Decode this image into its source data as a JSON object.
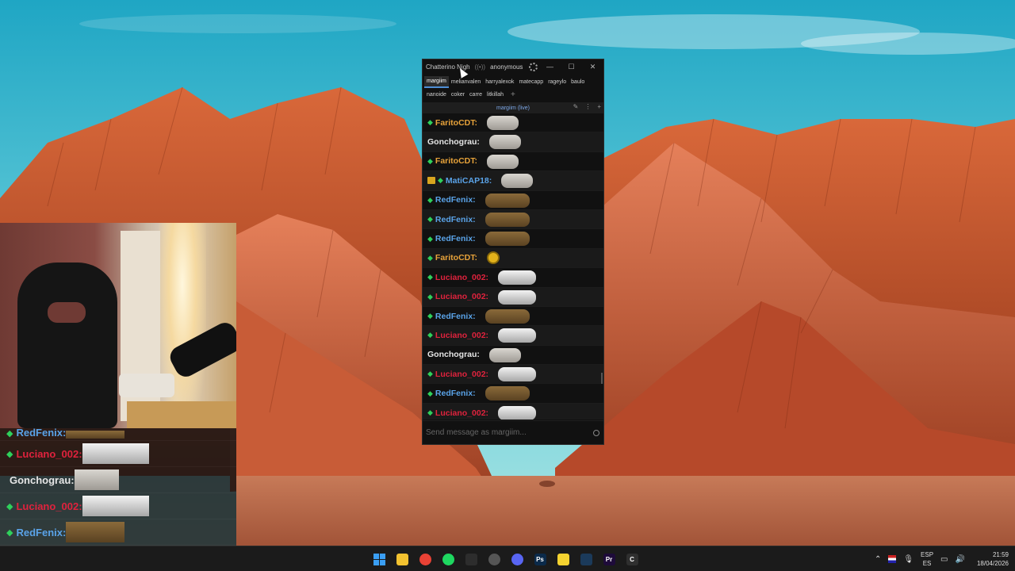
{
  "chatterino": {
    "title": "Chatterino Nigh",
    "account": "anonymous",
    "tabs_row1": [
      "margiim",
      "melianvalen",
      "harryalexok",
      "matecapp",
      "rageylo",
      "baulo"
    ],
    "tabs_row2": [
      "nanoide",
      "coker",
      "carre",
      "litkillah"
    ],
    "active_tab": "margiim",
    "split_title": "margiim (live)",
    "input_placeholder": "Send message as margiim...",
    "messages": [
      {
        "user": "FaritoCDT:",
        "color": "#e8a33a",
        "badge": "diamond",
        "emote": "seal"
      },
      {
        "user": "Gonchograu:",
        "color": "#e6e6e6",
        "badge": "none",
        "emote": "seal"
      },
      {
        "user": "FaritoCDT:",
        "color": "#e8a33a",
        "badge": "diamond",
        "emote": "seal"
      },
      {
        "user": "MatiCAP18:",
        "color": "#5aa3e8",
        "badge": "crown+diamond",
        "emote": "seal"
      },
      {
        "user": "RedFenix:",
        "color": "#5aa3e8",
        "badge": "diamond",
        "emote": "tank"
      },
      {
        "user": "RedFenix:",
        "color": "#5aa3e8",
        "badge": "diamond",
        "emote": "tank"
      },
      {
        "user": "RedFenix:",
        "color": "#5aa3e8",
        "badge": "diamond",
        "emote": "tank"
      },
      {
        "user": "FaritoCDT:",
        "color": "#e8a33a",
        "badge": "diamond",
        "emote": "coin"
      },
      {
        "user": "Luciano_002:",
        "color": "#e0223d",
        "badge": "diamond",
        "emote": "cat"
      },
      {
        "user": "Luciano_002:",
        "color": "#e0223d",
        "badge": "diamond",
        "emote": "cat"
      },
      {
        "user": "RedFenix:",
        "color": "#5aa3e8",
        "badge": "diamond",
        "emote": "tank"
      },
      {
        "user": "Luciano_002:",
        "color": "#e0223d",
        "badge": "diamond",
        "emote": "cat"
      },
      {
        "user": "Gonchograu:",
        "color": "#e6e6e6",
        "badge": "none",
        "emote": "seal"
      },
      {
        "user": "Luciano_002:",
        "color": "#e0223d",
        "badge": "diamond",
        "emote": "cat"
      },
      {
        "user": "RedFenix:",
        "color": "#5aa3e8",
        "badge": "diamond",
        "emote": "tank"
      },
      {
        "user": "Luciano_002:",
        "color": "#e0223d",
        "badge": "diamond",
        "emote": "cat"
      }
    ]
  },
  "overlay_chat": [
    {
      "user": "RedFenix:",
      "color": "#5aa3e8",
      "badge": "diamond",
      "emote": "tank",
      "partial": true
    },
    {
      "user": "Luciano_002:",
      "color": "#e0223d",
      "badge": "diamond",
      "emote": "cat"
    },
    {
      "user": "Gonchograu:",
      "color": "#e6e6e6",
      "badge": "none",
      "emote": "seal"
    },
    {
      "user": "Luciano_002:",
      "color": "#e0223d",
      "badge": "diamond",
      "emote": "cat"
    },
    {
      "user": "RedFenix:",
      "color": "#5aa3e8",
      "badge": "diamond",
      "emote": "tank"
    },
    {
      "user": "Luciano_002:",
      "color": "#e0223d",
      "badge": "diamond",
      "emote": "cat"
    }
  ],
  "taskbar": {
    "apps": [
      {
        "name": "start",
        "icon": "windows-icon",
        "color": "#3a9ff5",
        "glyph": ""
      },
      {
        "name": "file-explorer",
        "icon": "folder-icon",
        "color": "#f2c230",
        "glyph": ""
      },
      {
        "name": "chrome",
        "icon": "chrome-icon",
        "color": "#e94235",
        "glyph": ""
      },
      {
        "name": "spotify",
        "icon": "spotify-icon",
        "color": "#1ed760",
        "glyph": ""
      },
      {
        "name": "app-dark",
        "icon": "terminal-icon",
        "color": "#2d2d2d",
        "glyph": ""
      },
      {
        "name": "opera-gx",
        "icon": "opera-icon",
        "color": "#555555",
        "glyph": ""
      },
      {
        "name": "discord",
        "icon": "discord-icon",
        "color": "#5865f2",
        "glyph": ""
      },
      {
        "name": "photoshop",
        "icon": "photoshop-icon",
        "color": "#0b2a4a",
        "glyph": "Ps"
      },
      {
        "name": "sticky-notes",
        "icon": "note-icon",
        "color": "#f5d330",
        "glyph": ""
      },
      {
        "name": "steam",
        "icon": "steam-icon",
        "color": "#1b3a5a",
        "glyph": ""
      },
      {
        "name": "premiere",
        "icon": "premiere-icon",
        "color": "#1e0b3a",
        "glyph": "Pr"
      },
      {
        "name": "chatterino",
        "icon": "chatterino-icon",
        "color": "#2f2f2f",
        "glyph": "C"
      }
    ],
    "lang_top": "ESP",
    "lang_bottom": "ES",
    "time": "21:59",
    "date": "18/04/2026"
  }
}
